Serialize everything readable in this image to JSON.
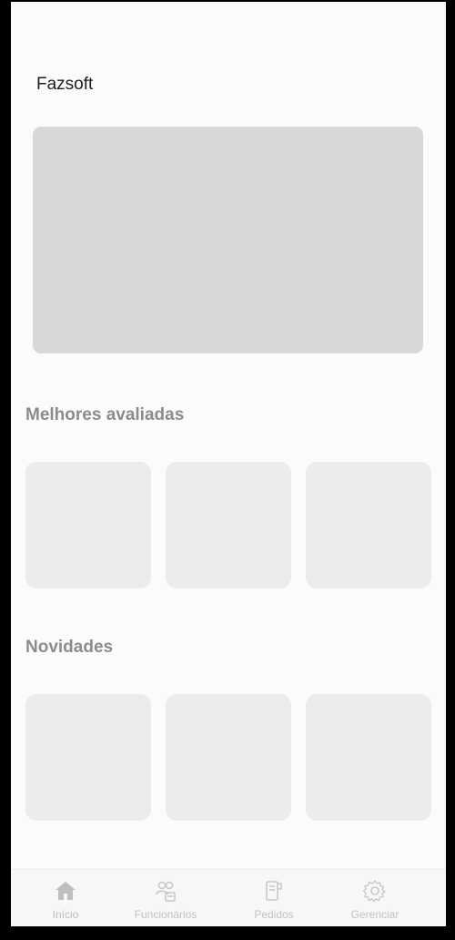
{
  "app": {
    "title": "Fazsoft"
  },
  "sections": {
    "top_rated": {
      "title": "Melhores avaliadas"
    },
    "new": {
      "title": "Novidades"
    }
  },
  "tabbar": {
    "items": [
      {
        "label": "Início",
        "icon": "home-icon",
        "active": true
      },
      {
        "label": "Funcionários",
        "icon": "employees-icon",
        "active": false
      },
      {
        "label": "Pedidos",
        "icon": "orders-icon",
        "active": false
      },
      {
        "label": "Gerenciar",
        "icon": "gear-icon",
        "active": false
      }
    ]
  },
  "colors": {
    "background": "#fbfbfb",
    "placeholder_banner": "#d8d8d8",
    "placeholder_card": "#ececec",
    "section_title": "#8c8c8c",
    "tab_inactive": "#c2c2c2"
  }
}
